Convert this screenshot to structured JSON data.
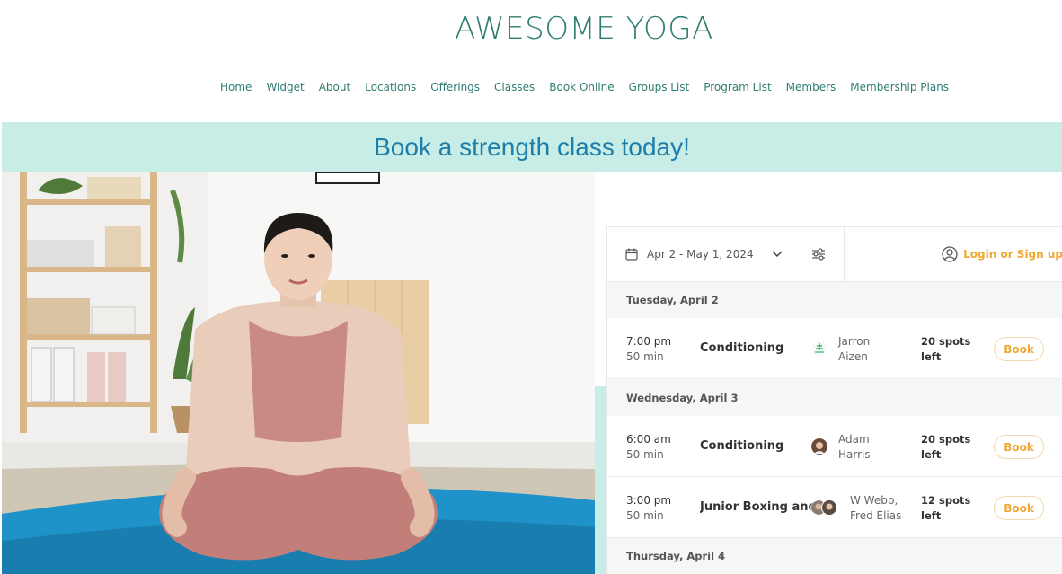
{
  "site": {
    "title": "AWESOME YOGA"
  },
  "nav": [
    "Home",
    "Widget",
    "About",
    "Locations",
    "Offerings",
    "Classes",
    "Book Online",
    "Groups List",
    "Program List",
    "Members",
    "Membership Plans"
  ],
  "banner": {
    "text": "Book a strength class today!"
  },
  "colors": {
    "accent": "#f0a832",
    "brand": "#2f7d72",
    "banner_bg": "#c8ede7",
    "banner_text": "#1e7eaa"
  },
  "widget": {
    "date_range": "Apr 2 - May 1, 2024",
    "login_label": "Login or Sign up",
    "days": [
      {
        "label": "Tuesday, April 2",
        "sessions": [
          {
            "time": "7:00 pm",
            "duration": "50 min",
            "name": "Conditioning",
            "staff_line1": "Jarron",
            "staff_line2": "Aizen",
            "spots_line1": "20 spots",
            "spots_line2": "left",
            "book": "Book",
            "avatar": "logo-avatar"
          }
        ]
      },
      {
        "label": "Wednesday, April 3",
        "sessions": [
          {
            "time": "6:00 am",
            "duration": "50 min",
            "name": "Conditioning",
            "staff_line1": "Adam",
            "staff_line2": "Harris",
            "spots_line1": "20 spots",
            "spots_line2": "left",
            "book": "Book",
            "avatar": "person-avatar"
          },
          {
            "time": "3:00 pm",
            "duration": "50 min",
            "name": "Junior Boxing and Fitness",
            "staff_line1": "W Webb,",
            "staff_line2": "Fred Elias",
            "spots_line1": "12 spots",
            "spots_line2": "left",
            "book": "Book",
            "avatar": "group-avatar"
          }
        ]
      },
      {
        "label": "Thursday, April 4",
        "sessions": []
      }
    ]
  }
}
